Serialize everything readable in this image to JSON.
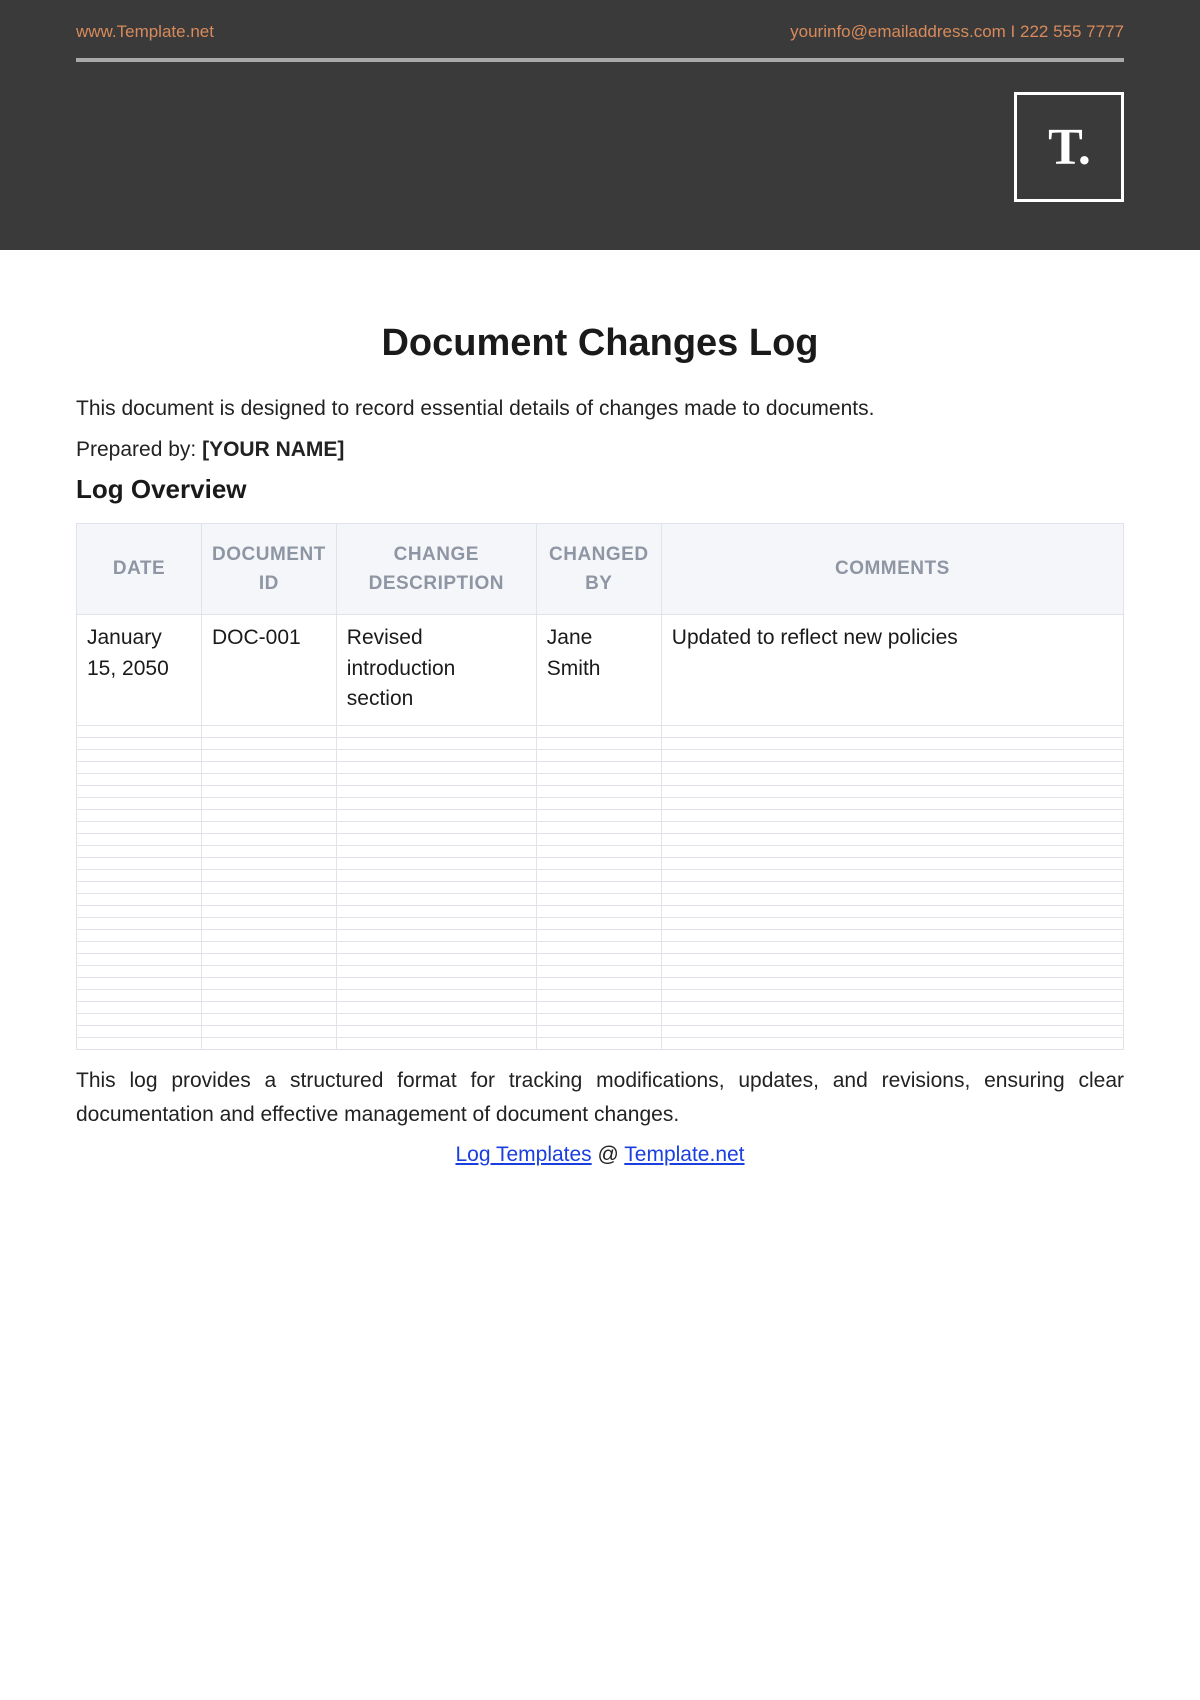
{
  "header": {
    "site": "www.Template.net",
    "email": "yourinfo@emailaddress.com",
    "sep": "  I  ",
    "phone": "222 555 7777",
    "logo": "T."
  },
  "doc": {
    "title": "Document Changes Log",
    "intro": "This document is designed to record essential details of changes made to documents.",
    "prepared_label": "Prepared by: ",
    "prepared_value": "[YOUR NAME]",
    "section": "Log Overview"
  },
  "table": {
    "headers": {
      "date": "DATE",
      "id": "DOCUMENT ID",
      "desc": "CHANGE DESCRIPTION",
      "by": "CHANGED BY",
      "comments": "COMMENTS"
    },
    "rows": [
      {
        "date": "January 15, 2050",
        "id": "DOC-001",
        "desc": "Revised introduction section",
        "by": "Jane Smith",
        "comments": "Updated to reflect new policies"
      }
    ],
    "empty_rows": 27
  },
  "outro": "This log provides a structured format for tracking modifications, updates, and revisions, ensuring clear documentation and effective management of document changes.",
  "footer": {
    "link1": "Log Templates",
    "at": " @ ",
    "link2": "Template.net"
  }
}
